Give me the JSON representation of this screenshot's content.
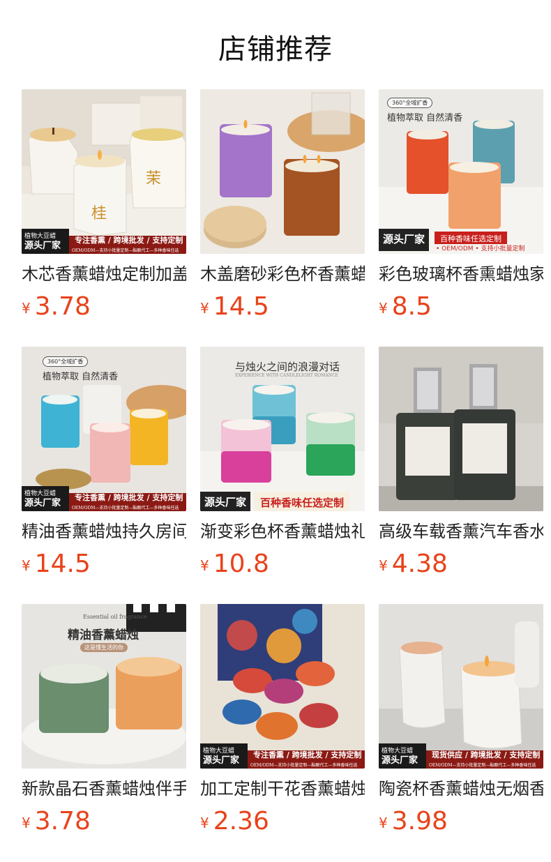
{
  "page": {
    "title": "店铺推荐"
  },
  "currency": "¥",
  "products": [
    {
      "name": "木芯香薰蜡烛定制加盖礼盒",
      "price": "3.78",
      "banner": {
        "badge": "植物大豆蜡",
        "badge2": "源头厂家",
        "text": "专注香熏 / 跨境批发 / 支持定制",
        "subtext": "OEM/ODM—支持小批量定制—酝酿代工—多种香味任选"
      },
      "label_chars": [
        "桂",
        "茉"
      ]
    },
    {
      "name": "木盖磨砂彩色杯香薰蜡烛",
      "price": "14.5"
    },
    {
      "name": "彩色玻璃杯香熏蜡烛家用",
      "price": "8.5",
      "top": {
        "pill": "360°全域扩香",
        "text": "植物萃取 自然清香"
      },
      "banner": {
        "badge": "源头厂家",
        "text": "百种香味任选定制",
        "subtext": "• OEM/ODM • 支持小批量定制"
      }
    },
    {
      "name": "精油香薰蜡烛持久房间",
      "price": "14.5",
      "top": {
        "pill": "360°全域扩香",
        "text": "植物萃取 自然清香"
      },
      "banner": {
        "badge": "植物大豆蜡",
        "badge2": "源头厂家",
        "text": "专注香熏 / 跨境批发 / 支持定制",
        "subtext": "OEM/ODM—支持小批量定制—酝酿代工—多种香味任选"
      }
    },
    {
      "name": "渐变彩色杯香薰蜡烛礼盒",
      "price": "10.8",
      "top": {
        "text": "与烛火之间的浪漫对话",
        "small": "EXPERIENCE WITH CANDLELIGHT ROMANCE"
      },
      "banner": {
        "badge": "源头厂家",
        "text": "百种香味任选定制"
      }
    },
    {
      "name": "高级车载香薰汽车香水",
      "price": "4.38"
    },
    {
      "name": "新款晶石香薰蜡烛伴手礼",
      "price": "3.78",
      "top": {
        "small": "Essential oil fragrance",
        "text": "精油香薰蜡烛",
        "pill": "这是懂生活的你"
      }
    },
    {
      "name": "加工定制干花香薰蜡烛罐",
      "price": "2.36",
      "banner": {
        "badge": "植物大豆蜡",
        "badge2": "源头厂家",
        "text": "专注香熏 / 跨境批发 / 支持定制",
        "subtext": "OEM/ODM—支持小批量定制—酝酿代工—多种香味任选"
      }
    },
    {
      "name": "陶瓷杯香薰蜡烛无烟香氛",
      "price": "3.98",
      "banner": {
        "badge": "植物大豆蜡",
        "badge2": "源头厂家",
        "text": "现货供应 / 跨境批发 / 支持定制",
        "subtext": "OEM/ODM—支持小批量定制—酝酿代工—多种香味任选"
      }
    }
  ]
}
